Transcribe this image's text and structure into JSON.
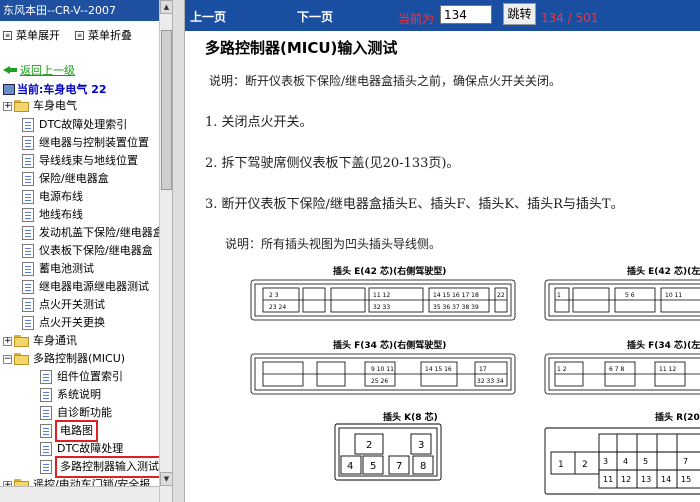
{
  "sidebar": {
    "title": "东风本田--CR-V--2007",
    "expand_all": "菜单展开",
    "collapse_all": "菜单折叠",
    "back": "返回上一级",
    "current": "当前:车身电气 22",
    "items": [
      {
        "label": "车身电气",
        "type": "folder"
      },
      {
        "label": "DTC故障处理索引",
        "type": "doc"
      },
      {
        "label": "继电器与控制装置位置",
        "type": "doc"
      },
      {
        "label": "导线线束与地线位置",
        "type": "doc"
      },
      {
        "label": "保险/继电器盒",
        "type": "doc"
      },
      {
        "label": "电源布线",
        "type": "doc"
      },
      {
        "label": "地线布线",
        "type": "doc"
      },
      {
        "label": "发动机盖下保险/继电器盒",
        "type": "doc"
      },
      {
        "label": "仪表板下保险/继电器盒",
        "type": "doc"
      },
      {
        "label": "蓄电池测试",
        "type": "doc"
      },
      {
        "label": "继电器电源继电器测试",
        "type": "doc"
      },
      {
        "label": "点火开关测试",
        "type": "doc"
      },
      {
        "label": "点火开关更换",
        "type": "doc"
      },
      {
        "label": "车身通讯",
        "type": "folder"
      },
      {
        "label": "多路控制器(MICU)",
        "type": "folder"
      },
      {
        "label": "组件位置索引",
        "type": "doc"
      },
      {
        "label": "系统说明",
        "type": "doc"
      },
      {
        "label": "自诊断功能",
        "type": "doc"
      },
      {
        "label": "电路图",
        "type": "doc"
      },
      {
        "label": "DTC故障处理",
        "type": "doc"
      },
      {
        "label": "多路控制器输入测试",
        "type": "doc"
      },
      {
        "label": "遥控/电动车门锁/安全报",
        "type": "folder"
      },
      {
        "label": "防起动装置系统",
        "type": "folder"
      }
    ]
  },
  "toolbar": {
    "prev": "上一页",
    "next": "下一页",
    "current_label": "当前为",
    "page_value": "134",
    "go": "跳转",
    "page_count": "134 / 501"
  },
  "content": {
    "title": "多路控制器(MICU)输入测试",
    "note1": "说明：断开仪表板下保险/继电器盒插头之前，确保点火开关关闭。",
    "step1": "1. 关闭点火开关。",
    "step2": "2. 拆下驾驶席侧仪表板下盖(见20-133页)。",
    "step3": "3. 断开仪表板下保险/继电器盒插头E、插头F、插头K、插头R与插头T。",
    "note2": "说明：所有插头视图为凹头插头导线侧。",
    "connector_e_left": "插头 E(42 芯)(右侧驾驶型)",
    "connector_e_right": "插头 E(42 芯)(左侧",
    "connector_f_left": "插头 F(34 芯)(右侧驾驶型)",
    "connector_f_right": "插头 F(34 芯)(左侧",
    "connector_k": "插头 K(8 芯)",
    "connector_r": "插头 R(20 芯"
  },
  "colors": {
    "header_blue": "#1a4ea0",
    "sidebar_title_blue": "#2050a0",
    "accent_red": "#ff3030",
    "highlight_red": "#e02020",
    "back_green": "#1a9a1a"
  }
}
